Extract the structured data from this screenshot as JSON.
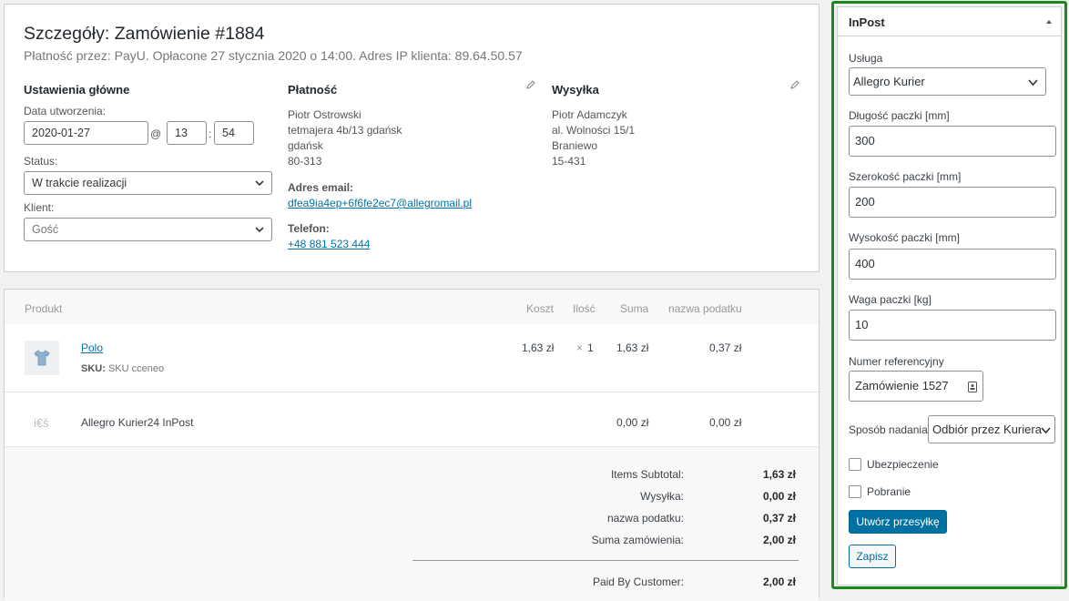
{
  "order": {
    "title": "Szczegóły: Zamówienie #1884",
    "meta": "Płatność przez: PayU. Opłacone 27 stycznia 2020 o 14:00. Adres IP klienta: 89.64.50.57",
    "general": {
      "heading": "Ustawienia główne",
      "date_label": "Data utworzenia:",
      "date_value": "2020-01-27",
      "at_sign": "@",
      "hour": "13",
      "colon": ":",
      "minute": "54",
      "status_label": "Status:",
      "status_value": "W trakcie realizacji",
      "client_label": "Klient:",
      "client_value": "Gość"
    },
    "billing": {
      "heading": "Płatność",
      "lines": [
        "Piotr Ostrowski",
        "tetmajera 4b/13 gdańsk",
        "gdańsk",
        "80-313"
      ],
      "email_label": "Adres email:",
      "email": "dfea9ia4ep+6f6fe2ec7@allegromail.pl",
      "phone_label": "Telefon:",
      "phone": "+48 881 523 444"
    },
    "shipping": {
      "heading": "Wysyłka",
      "lines": [
        "Piotr Adamczyk",
        "al. Wolności 15/1",
        "Braniewo",
        "15-431"
      ]
    }
  },
  "items": {
    "headers": {
      "product": "Produkt",
      "cost": "Koszt",
      "qty": "Ilość",
      "total": "Suma",
      "tax": "nazwa podatku"
    },
    "product": {
      "name": "Polo",
      "sku_label": "SKU:",
      "sku_value": "SKU cceneo",
      "cost": "1,63 zł",
      "qty_prefix": "×",
      "qty": "1",
      "total": "1,63 zł",
      "tax": "0,37 zł"
    },
    "shipping": {
      "icon_text": "i€š",
      "name": "Allegro Kurier24 InPost",
      "total": "0,00 zł",
      "tax": "0,00 zł"
    },
    "totals": [
      {
        "label": "Items Subtotal:",
        "value": "1,63 zł"
      },
      {
        "label": "Wysyłka:",
        "value": "0,00 zł"
      },
      {
        "label": "nazwa podatku:",
        "value": "0,37 zł"
      },
      {
        "label": "Suma zamówienia:",
        "value": "2,00 zł"
      }
    ],
    "paid": {
      "label": "Paid By Customer:",
      "value": "2,00 zł"
    }
  },
  "inpost": {
    "title": "InPost",
    "service_label": "Usługa",
    "service_value": "Allegro Kurier",
    "length_label": "Długość paczki [mm]",
    "length_value": "300",
    "width_label": "Szerokość paczki [mm]",
    "width_value": "200",
    "height_label": "Wysokość paczki [mm]",
    "height_value": "400",
    "weight_label": "Waga paczki [kg]",
    "weight_value": "10",
    "ref_label": "Numer referencyjny",
    "ref_value": "Zamówienie 1527",
    "method_label": "Sposób nadania",
    "method_value": "Odbiór przez Kuriera",
    "insurance_label": "Ubezpieczenie",
    "cod_label": "Pobranie",
    "create_button": "Utwórz przesyłkę",
    "save_button": "Zapisz"
  },
  "colors": {
    "highlight_border": "#1a8a1a",
    "primary_button": "#0071a1",
    "link": "#0073aa"
  }
}
